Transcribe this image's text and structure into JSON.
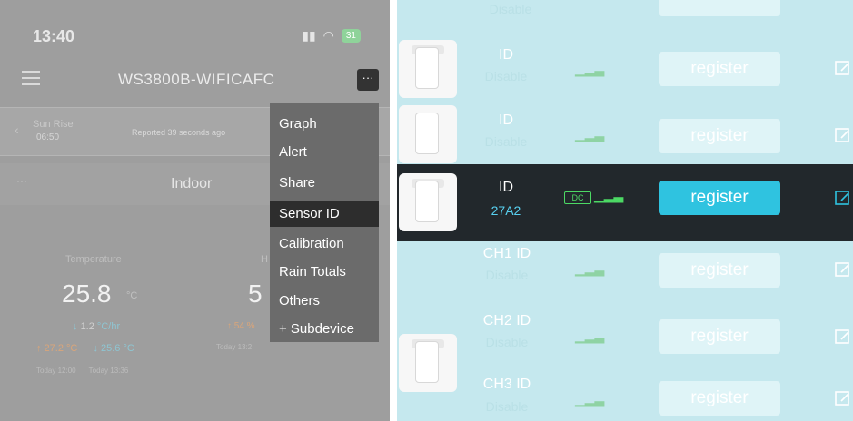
{
  "left": {
    "status": {
      "time": "13:40",
      "signal_text": "..!! ",
      "battery_text": "31"
    },
    "app_title": "WS3800B-WIFICAFC",
    "more_label": "···",
    "sun": {
      "label": "Sun Rise",
      "time": "06:50",
      "reported": "Reported 39 seconds ago"
    },
    "indoor": {
      "dots": "···",
      "title": "Indoor"
    },
    "temperature": {
      "label": "Temperature",
      "value": "25.8",
      "unit": "°C",
      "rate_arrow": "↓",
      "rate": "1.2",
      "rate_unit": "°C/hr",
      "max": "↑ 27.2 °C",
      "min": "↓ 25.6 °C",
      "max_time": "Today 12:00",
      "min_time": "Today 13:36"
    },
    "humidity": {
      "label": "H",
      "value": "5",
      "change": "↑ 54 %",
      "today": "Today 13:2"
    },
    "dropdown": [
      "Graph",
      "Alert",
      "Share",
      "Sensor ID",
      "Calibration",
      "Rain Totals",
      "Others",
      "+ Subdevice"
    ],
    "dropdown_active": "Sensor ID"
  },
  "right": {
    "top_partial": "Disable",
    "rows": [
      {
        "id": "ID",
        "sub": "Disable",
        "button": "register"
      },
      {
        "id": "ID",
        "sub": "Disable",
        "button": "register"
      },
      {
        "id": "ID",
        "sub": "27A2",
        "button": "register",
        "active": true,
        "badge": "DC"
      },
      {
        "id": "CH1 ID",
        "sub": "Disable",
        "button": "register"
      },
      {
        "id": "CH2 ID",
        "sub": "Disable",
        "button": "register"
      },
      {
        "id": "CH3 ID",
        "sub": "Disable",
        "button": "register"
      }
    ]
  },
  "colors": {
    "accent": "#2fc3e0",
    "active_row_bg": "#22282c",
    "signal_green": "#4cd964",
    "panel_gray": "#9e9e9e"
  }
}
